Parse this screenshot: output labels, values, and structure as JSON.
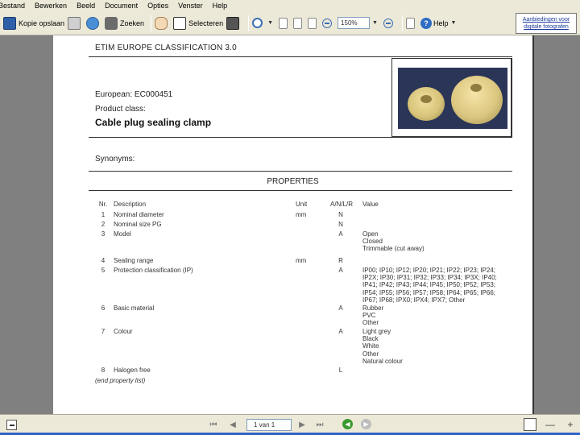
{
  "menubar": {
    "items": [
      "Bestand",
      "Bewerken",
      "Beeld",
      "Document",
      "Opties",
      "Venster",
      "Help"
    ]
  },
  "toolbar": {
    "save_label": "Kopie opslaan",
    "find_label": "Zoeken",
    "select_label": "Selecteren",
    "zoom_value": "150%",
    "help_label": "Help",
    "ad_text_line1": "Aanbiedingen voor",
    "ad_text_line2": "digitale fotografen"
  },
  "document": {
    "header": "ETIM EUROPE CLASSIFICATION 3.0",
    "european": "European:  EC000451",
    "product_class_label": "Product class:",
    "product_class": "Cable plug sealing clamp",
    "synonyms": "Synonyms:",
    "properties_title": "PROPERTIES",
    "columns": {
      "nr": "Nr.",
      "description": "Description",
      "unit": "Unit",
      "anlr": "A/N/L/R",
      "value": "Value"
    },
    "properties": [
      {
        "nr": "1",
        "description": "Nominal diameter",
        "unit": "mm",
        "anlr": "N",
        "values": []
      },
      {
        "nr": "2",
        "description": "Nominal size PG",
        "unit": "",
        "anlr": "N",
        "values": []
      },
      {
        "nr": "3",
        "description": "Model",
        "unit": "",
        "anlr": "A",
        "values": [
          "Open",
          "Closed",
          "Trimmable (cut away)"
        ]
      },
      {
        "nr": "4",
        "description": "Sealing range",
        "unit": "mm",
        "anlr": "R",
        "values": []
      },
      {
        "nr": "5",
        "description": "Protection classification (IP)",
        "unit": "",
        "anlr": "A",
        "values": [
          "IP00; IP10; IP12; IP20; IP21; IP22; IP23; IP24;",
          "IP2X; IP30; IP31; IP32; IP33; IP34; IP3X; IP40;",
          "IP41; IP42; IP43; IP44; IP45; IP50; IP52; IP53;",
          "IP54; IP55; IP56; IP57; IP58; IP64; IP65; IP66;",
          "IP67; IP68; IPX0; IPX4; IPX7; Other"
        ]
      },
      {
        "nr": "6",
        "description": "Basic material",
        "unit": "",
        "anlr": "A",
        "values": [
          "Rubber",
          "PVC",
          "Other"
        ]
      },
      {
        "nr": "7",
        "description": "Colour",
        "unit": "",
        "anlr": "A",
        "values": [
          "Light grey",
          "Black",
          "White",
          "Other",
          "Natural colour"
        ]
      },
      {
        "nr": "8",
        "description": "Halogen free",
        "unit": "",
        "anlr": "L",
        "values": []
      }
    ],
    "end_text": "(end property list)"
  },
  "statusbar": {
    "page_indicator": "1 van 1"
  }
}
